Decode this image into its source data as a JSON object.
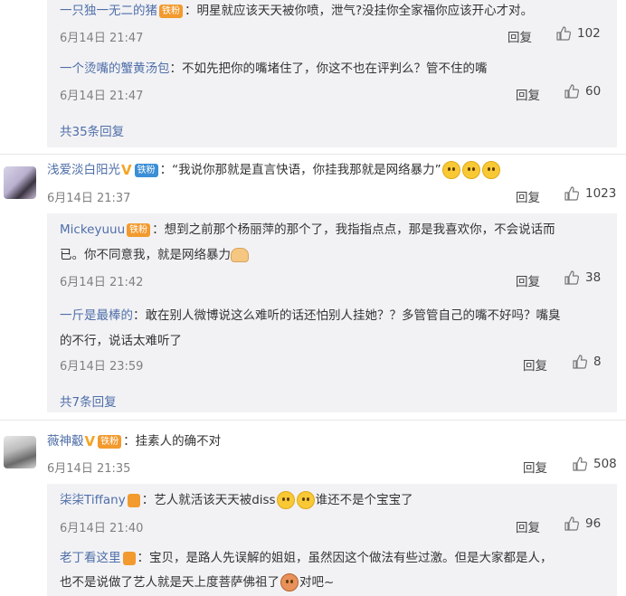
{
  "thread1": {
    "r1": {
      "name": "一只独一无二的猪",
      "badge": "铁粉",
      "text": "：明星就应该天天被你喷，泄气?没挂你全家福你应该开心才对。",
      "time": "6月14日 21:47",
      "reply": "回复",
      "likes": "102"
    },
    "r2": {
      "name": "一个烫嘴的蟹黄汤包",
      "text": "：不如先把你的嘴堵住了，你这不也在评判么？管不住的嘴",
      "time": "6月14日 21:47",
      "reply": "回复",
      "likes": "60"
    },
    "more": "共35条回复"
  },
  "c2": {
    "name": "浅爱淡白阳光",
    "badge": "铁粉",
    "text": "：“我说你那就是直言快语，你挂我那就是网络暴力”",
    "time": "6月14日 21:37",
    "reply": "回复",
    "likes": "1023",
    "r1": {
      "name": "Mickeyuuu",
      "badge": "铁粉",
      "line1": "：想到之前那个杨丽萍的那个了，我指指点点，那是我喜欢你，不会说话而",
      "line2": "已。你不同意我，就是网络暴力",
      "time": "6月14日 21:42",
      "reply": "回复",
      "likes": "38"
    },
    "r2": {
      "name": "一斤是最棒的",
      "line1": "：敢在别人微博说这么难听的话还怕别人挂她？？多管管自己的嘴不好吗？嘴臭",
      "line2": "的不行，说话太难听了",
      "time": "6月14日 23:59",
      "reply": "回复",
      "likes": "8"
    },
    "more": "共7条回复"
  },
  "c3": {
    "name": "薇神觳",
    "badge": "铁粉",
    "text": "：挂素人的确不对",
    "time": "6月14日 21:35",
    "reply": "回复",
    "likes": "508",
    "r1": {
      "name": "柒柒Tiffany",
      "text1": "：艺人就活该天天被diss",
      "text2": "谁还不是个宝宝了",
      "time": "6月14日 21:40",
      "reply": "回复",
      "likes": "96"
    },
    "r2": {
      "name": "老丁看这里",
      "line1": "：宝贝，是路人先误解的姐姐，虽然因这个做法有些过激。但是大家都是人，",
      "line2": "也不是说做了艺人就是天上度菩萨佛祖了",
      "line2b": "对吧~"
    }
  },
  "colors": {
    "link": "#4f6ea8",
    "reply_bg": "#f2f2f5",
    "badge_fan": "#f29a2e",
    "badge_iron": "#3b8fd6"
  }
}
